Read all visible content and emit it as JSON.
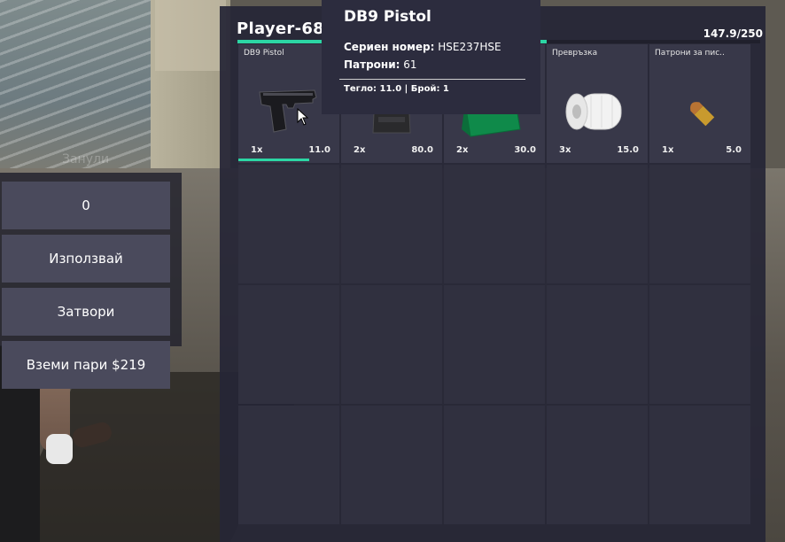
{
  "background": {
    "ghost_text": "Занули"
  },
  "actions": {
    "amount_value": "0",
    "use_label": "Използвай",
    "close_label": "Затвори",
    "take_money_label": "Вземи пари $219"
  },
  "inventory": {
    "title": "Player-68",
    "weight_text": "147.9/250",
    "weight_fraction": 0.5916,
    "accent_color": "#2cd6a4",
    "slots": [
      {
        "label": "DB9 Pistol",
        "count": "1x",
        "weight": "11.0",
        "icon": "pistol-icon",
        "durability": 0.7
      },
      {
        "label": "",
        "count": "2x",
        "weight": "80.0",
        "icon": "armor-vest-icon"
      },
      {
        "label": "",
        "count": "2x",
        "weight": "30.0",
        "icon": "first-aid-kit-icon"
      },
      {
        "label": "Превръзка",
        "count": "3x",
        "weight": "15.0",
        "icon": "bandage-icon"
      },
      {
        "label": "Патрони за пис..",
        "count": "1x",
        "weight": "5.0",
        "icon": "pistol-ammo-icon"
      }
    ],
    "empty_slot_count": 15
  },
  "tooltip": {
    "title": "DB9 Pistol",
    "serial_label": "Сериен номер:",
    "serial_value": "HSE237HSE",
    "ammo_label": "Патрони:",
    "ammo_value": "61",
    "footer": "Тегло: 11.0 | Брой: 1"
  }
}
